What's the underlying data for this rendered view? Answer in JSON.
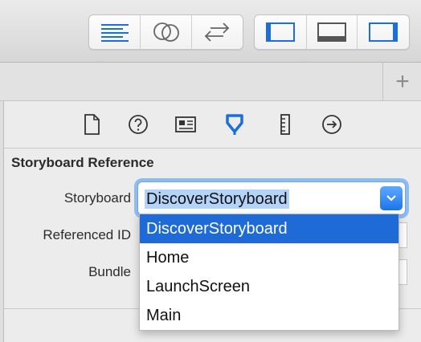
{
  "toolbar": {
    "editor_buttons": [
      "standard-editor-icon",
      "assistant-editor-icon",
      "version-editor-icon"
    ],
    "view_buttons": [
      "navigator-panel-icon",
      "debug-area-icon",
      "utilities-panel-icon"
    ],
    "accent": "#1a6fdc"
  },
  "tabstrip": {
    "add_label": "+"
  },
  "inspector": {
    "tabs": [
      "file-inspector-icon",
      "quick-help-icon",
      "identity-inspector-icon",
      "attributes-inspector-icon",
      "size-inspector-icon",
      "connections-inspector-icon"
    ],
    "active_tab": "attributes-inspector-icon",
    "section_title": "Storyboard Reference",
    "fields": {
      "storyboard_label": "Storyboard",
      "storyboard_value": "DiscoverStoryboard",
      "referenced_id_label": "Referenced ID",
      "bundle_label": "Bundle"
    }
  },
  "dropdown": {
    "options": [
      "DiscoverStoryboard",
      "Home",
      "LaunchScreen",
      "Main"
    ],
    "selected": "DiscoverStoryboard"
  }
}
